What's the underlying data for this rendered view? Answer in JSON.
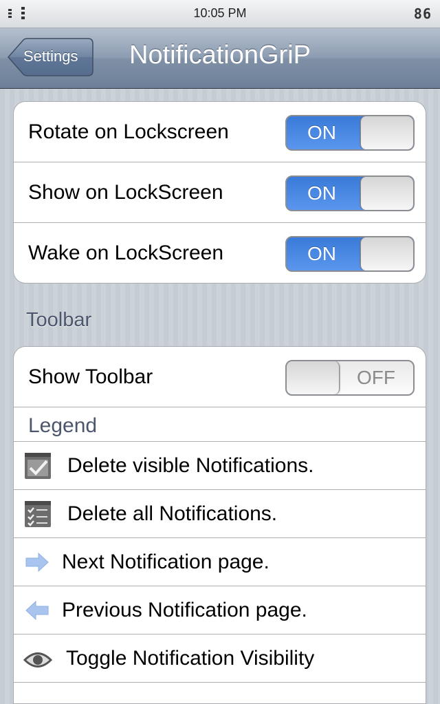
{
  "status_bar": {
    "time": "10:05 PM",
    "battery": "86"
  },
  "nav": {
    "back_label": "Settings",
    "title": "NotificationGriP"
  },
  "lockscreen_group": {
    "rows": [
      {
        "label": "Rotate on Lockscreen",
        "state": "ON"
      },
      {
        "label": "Show on LockScreen",
        "state": "ON"
      },
      {
        "label": "Wake on LockScreen",
        "state": "ON"
      }
    ]
  },
  "toolbar_section": {
    "header": "Toolbar",
    "show_toolbar": {
      "label": "Show Toolbar",
      "state": "OFF"
    },
    "legend_title": "Legend",
    "legend_items": [
      {
        "icon": "delete-visible-icon",
        "text": "Delete visible Notifications."
      },
      {
        "icon": "delete-all-icon",
        "text": "Delete all Notifications."
      },
      {
        "icon": "right-arrow-icon",
        "text": "Next Notification page."
      },
      {
        "icon": "left-arrow-icon",
        "text": "Previous Notification page."
      },
      {
        "icon": "eye-icon",
        "text": "Toggle Notification Visibility"
      }
    ]
  },
  "colors": {
    "toggle_on": "#3a7bd8",
    "section_header": "#4c566c",
    "nav_bar": "#8d9db2"
  }
}
